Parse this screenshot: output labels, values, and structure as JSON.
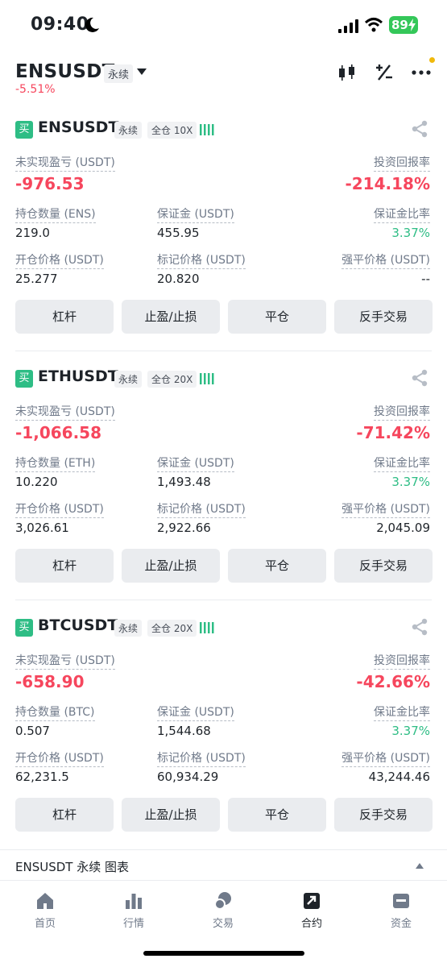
{
  "status": {
    "time": "09:40",
    "battery": "89"
  },
  "header": {
    "title": "ENSUSDT",
    "tag": "永续",
    "change": "-5.51%"
  },
  "labels": {
    "unrealized": "未实现盈亏 (USDT)",
    "roi": "投资回报率",
    "margin": "保证金 (USDT)",
    "margin_ratio": "保证金比率",
    "entry": "开仓价格 (USDT)",
    "mark": "标记价格 (USDT)",
    "liq": "强平价格 (USDT)"
  },
  "buttons": {
    "leverage": "杠杆",
    "tpsl": "止盈/止损",
    "close": "平仓",
    "reverse": "反手交易"
  },
  "positions": [
    {
      "side": "买",
      "symbol": "ENSUSDT",
      "tag": "永续",
      "mode": "全仓 10X",
      "size_label": "持仓数量 (ENS)",
      "pnl": "-976.53",
      "roi": "-214.18%",
      "size": "219.0",
      "margin": "455.95",
      "margin_ratio": "3.37%",
      "entry": "25.277",
      "mark": "20.820",
      "liq": "--"
    },
    {
      "side": "买",
      "symbol": "ETHUSDT",
      "tag": "永续",
      "mode": "全仓 20X",
      "size_label": "持仓数量 (ETH)",
      "pnl": "-1,066.58",
      "roi": "-71.42%",
      "size": "10.220",
      "margin": "1,493.48",
      "margin_ratio": "3.37%",
      "entry": "3,026.61",
      "mark": "2,922.66",
      "liq": "2,045.09"
    },
    {
      "side": "买",
      "symbol": "BTCUSDT",
      "tag": "永续",
      "mode": "全仓 20X",
      "size_label": "持仓数量 (BTC)",
      "pnl": "-658.90",
      "roi": "-42.66%",
      "size": "0.507",
      "margin": "1,544.68",
      "margin_ratio": "3.37%",
      "entry": "62,231.5",
      "mark": "60,934.29",
      "liq": "43,244.46"
    }
  ],
  "chart_bar": {
    "text": "ENSUSDT 永续  图表"
  },
  "tabs": [
    {
      "label": "首页",
      "icon": "home-icon"
    },
    {
      "label": "行情",
      "icon": "chart-bars-icon"
    },
    {
      "label": "交易",
      "icon": "trade-coins-icon"
    },
    {
      "label": "合约",
      "icon": "futures-icon"
    },
    {
      "label": "资金",
      "icon": "wallet-icon"
    }
  ],
  "colors": {
    "red": "#f6465d",
    "green": "#2ebd85",
    "gold": "#f0b90b"
  }
}
